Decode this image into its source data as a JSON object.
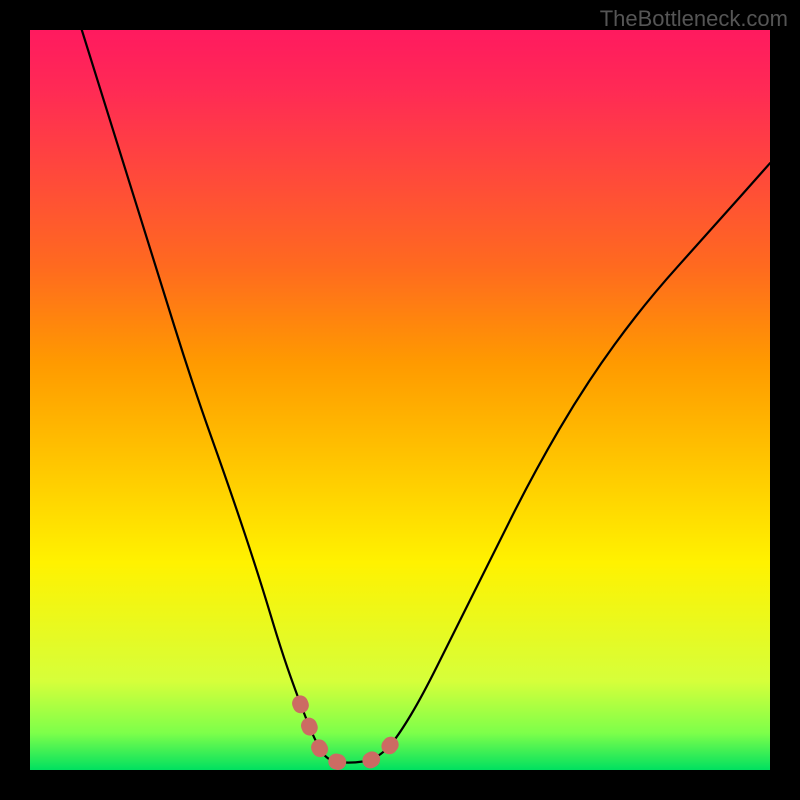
{
  "watermark": "TheBottleneck.com",
  "chart_data": {
    "type": "line",
    "title": "",
    "xlabel": "",
    "ylabel": "",
    "xlim": [
      0,
      100
    ],
    "ylim": [
      0,
      100
    ],
    "series": [
      {
        "name": "bottleneck-curve",
        "x": [
          7,
          12,
          17,
          22,
          27,
          31,
          34,
          36.5,
          38.5,
          40,
          42,
          44,
          46,
          48,
          50,
          53,
          57,
          62,
          68,
          75,
          83,
          92,
          100
        ],
        "values": [
          100,
          84,
          68,
          52,
          38,
          26,
          16,
          9,
          4,
          1.5,
          1,
          1,
          1.3,
          2.5,
          5,
          10,
          18,
          28,
          40,
          52,
          63,
          73,
          82
        ]
      }
    ],
    "annotations": [
      {
        "name": "valley-left-blob",
        "x_range": [
          36,
          41
        ],
        "y_range": [
          1,
          9
        ]
      },
      {
        "name": "valley-right-blob",
        "x_range": [
          46,
          50
        ],
        "y_range": [
          1,
          6
        ]
      }
    ],
    "gradient_stops": [
      {
        "pos": 0.0,
        "color": "#00e060"
      },
      {
        "pos": 0.05,
        "color": "#7dff4a"
      },
      {
        "pos": 0.12,
        "color": "#d6ff3a"
      },
      {
        "pos": 0.28,
        "color": "#fff200"
      },
      {
        "pos": 0.42,
        "color": "#ffc400"
      },
      {
        "pos": 0.55,
        "color": "#ff9a00"
      },
      {
        "pos": 0.68,
        "color": "#ff6a1f"
      },
      {
        "pos": 0.8,
        "color": "#ff4a3a"
      },
      {
        "pos": 0.92,
        "color": "#ff2a55"
      },
      {
        "pos": 1.0,
        "color": "#ff1a5f"
      }
    ]
  }
}
